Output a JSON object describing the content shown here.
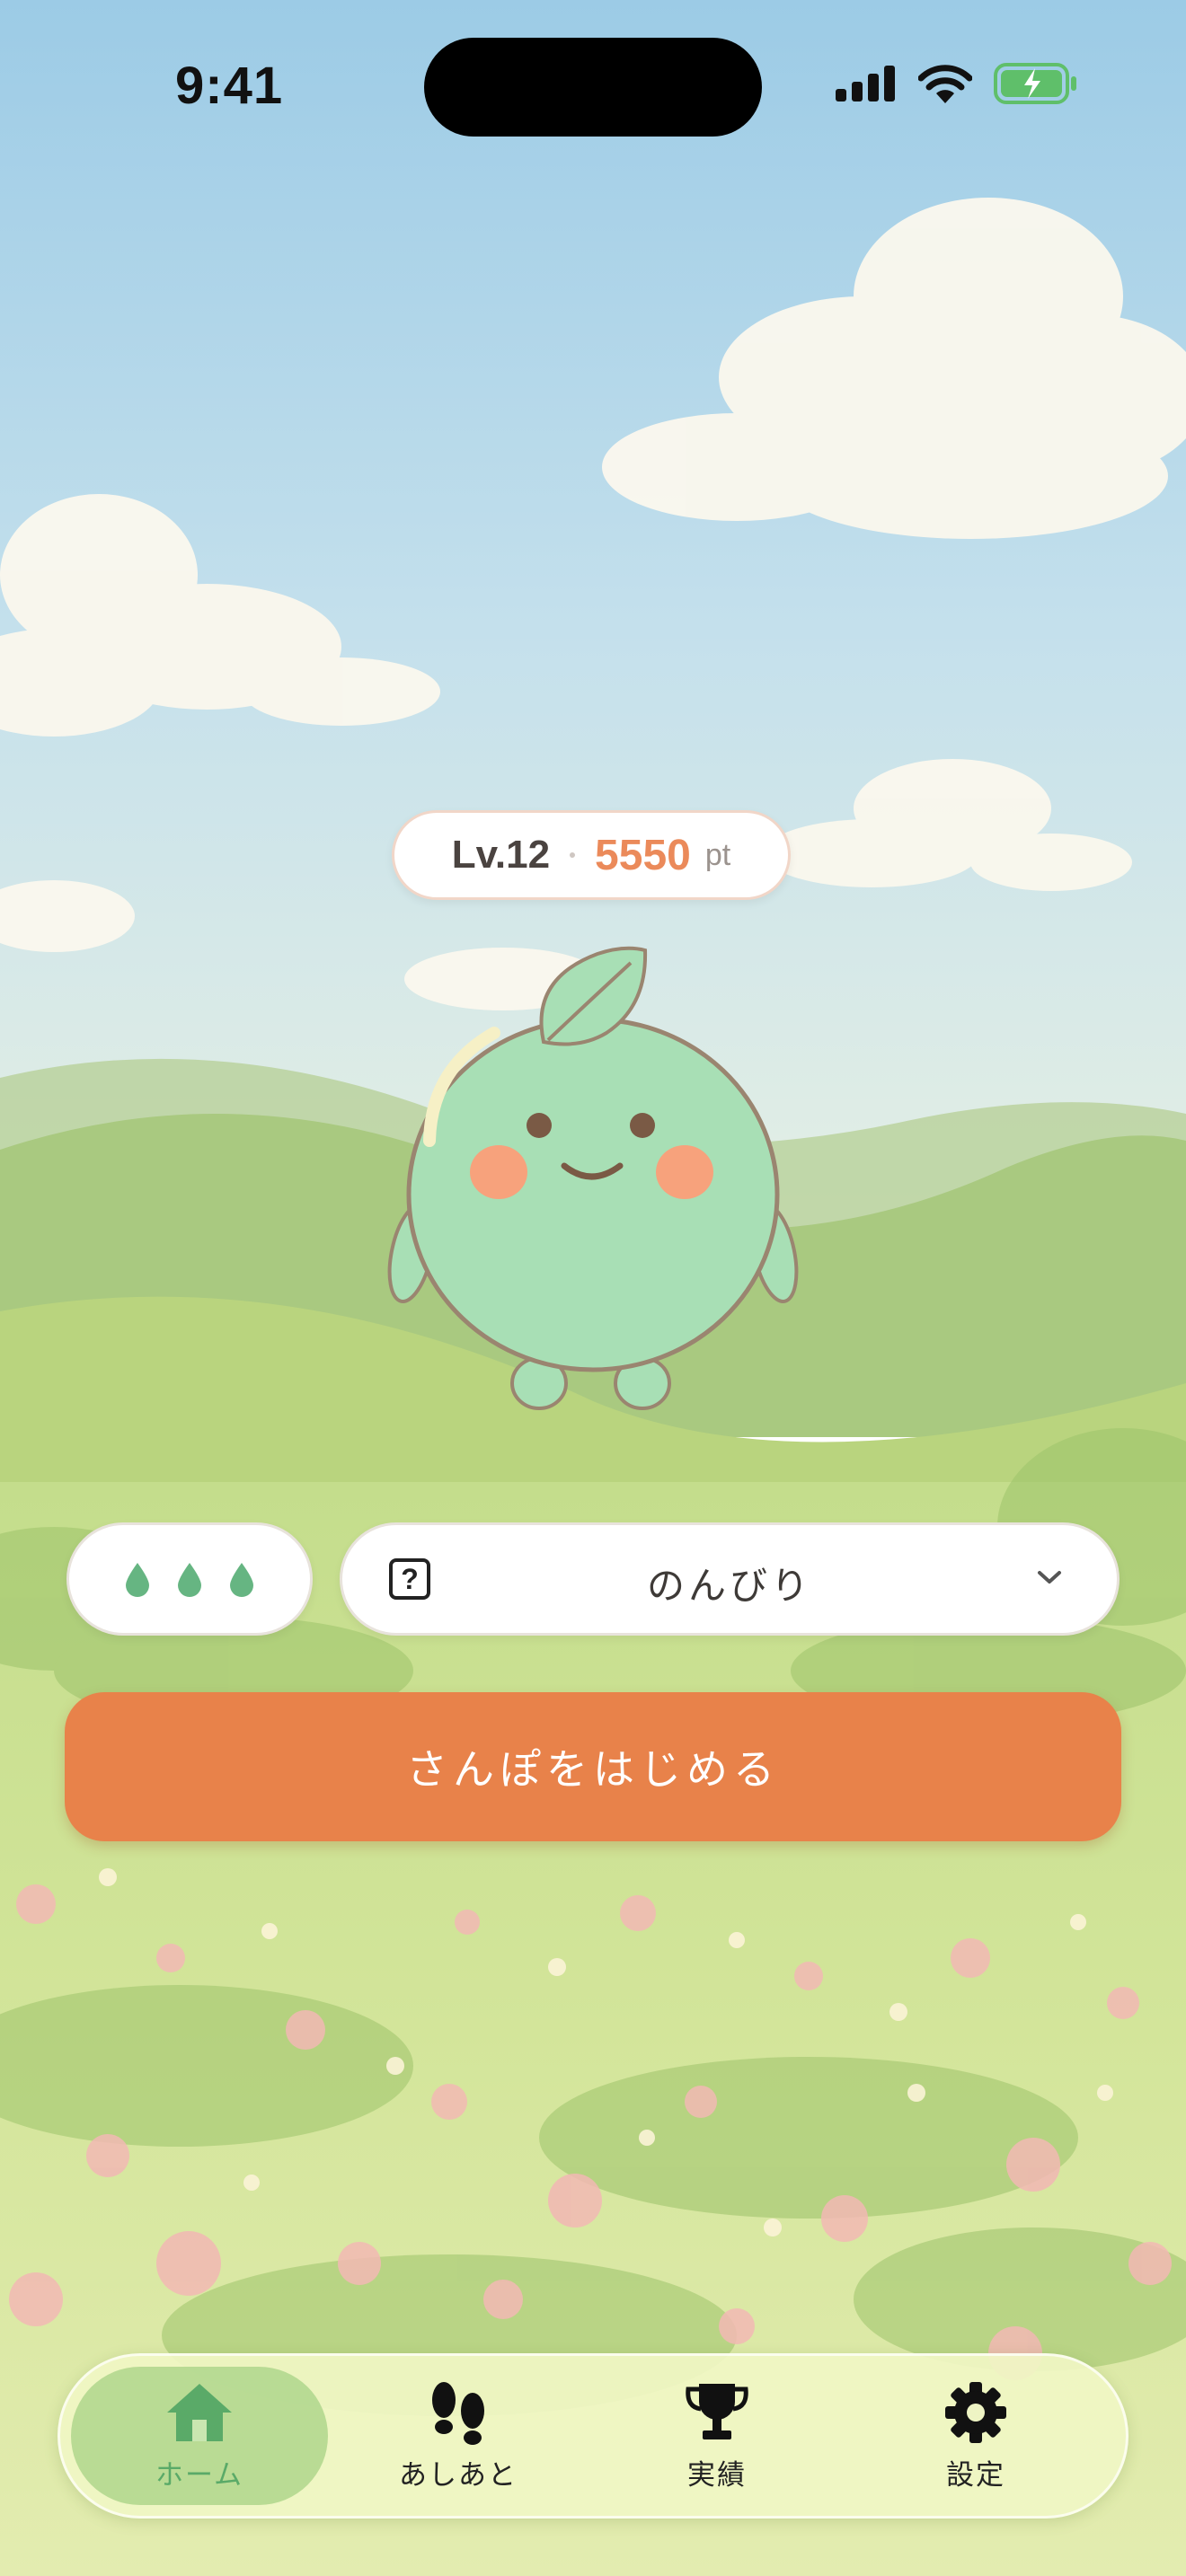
{
  "status_bar": {
    "time": "9:41",
    "icons": [
      "cellular-signal-icon",
      "wifi-icon",
      "battery-charging-icon"
    ]
  },
  "level": {
    "label": "Lv.12",
    "points": "5550",
    "unit": "pt"
  },
  "drops": {
    "count": 3,
    "icon": "water-drop-icon",
    "color": "#66b582"
  },
  "mood": {
    "selected": "のんびり",
    "help_icon": "question-mark-icon",
    "chevron_icon": "chevron-down-icon"
  },
  "start_button": {
    "label": "さんぽをはじめる",
    "color": "#e8824a"
  },
  "tabs": [
    {
      "label": "ホーム",
      "icon": "home-icon",
      "active": true
    },
    {
      "label": "あしあと",
      "icon": "footprints-icon",
      "active": false
    },
    {
      "label": "実績",
      "icon": "trophy-icon",
      "active": false
    },
    {
      "label": "設定",
      "icon": "gear-icon",
      "active": false
    }
  ],
  "colors": {
    "accent": "#e8824a",
    "points": "#eb8a5a",
    "character_body": "#a8dfb5",
    "active_tab": "#5aaa68"
  }
}
